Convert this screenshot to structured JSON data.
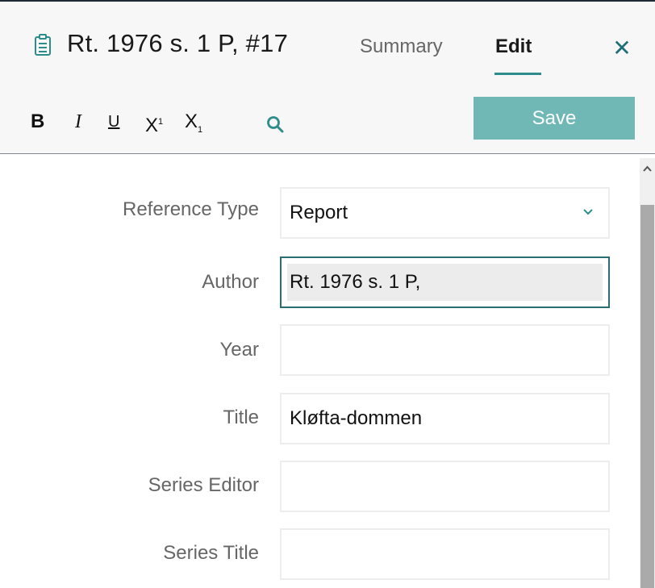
{
  "header": {
    "reference_title": "Rt. 1976 s. 1 P,  #17",
    "tabs": [
      {
        "label": "Summary",
        "active": false
      },
      {
        "label": "Edit",
        "active": true
      }
    ],
    "close_glyph": "✕"
  },
  "toolbar": {
    "bold": "B",
    "italic": "I",
    "underline": "U",
    "superscript_base": "X",
    "superscript_mark": "1",
    "subscript_base": "X",
    "subscript_mark": "1",
    "save_label": "Save"
  },
  "form": {
    "fields": [
      {
        "label": "Reference Type",
        "value": "Report"
      },
      {
        "label": "Author",
        "value": "Rt. 1976 s. 1 P,"
      },
      {
        "label": "Year",
        "value": ""
      },
      {
        "label": "Title",
        "value": "Kløfta-dommen"
      },
      {
        "label": "Series Editor",
        "value": ""
      },
      {
        "label": "Series Title",
        "value": ""
      }
    ]
  },
  "colors": {
    "accent": "#2f8c8c",
    "save_button": "#6fb8b6",
    "header_background": "#f7f7f7",
    "label_text": "#666666"
  },
  "icons": {
    "reference": "clipboard-icon",
    "search": "search-icon",
    "close": "close-icon",
    "dropdown": "chevron-down-icon",
    "scroll_up": "chevron-up-icon"
  }
}
